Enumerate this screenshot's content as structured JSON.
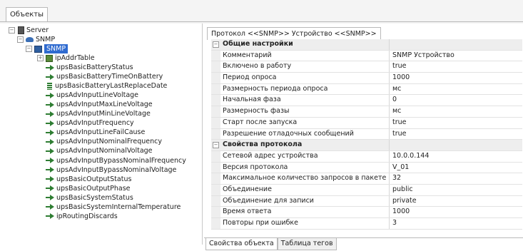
{
  "top_tab": "Объекты",
  "tree": {
    "server": "Server",
    "snmp_group": "SNMP",
    "snmp_device": "SNMP",
    "ip_addr_table": "ipAddrTable",
    "items": [
      "upsBasicBatteryStatus",
      "upsBasicBatteryTimeOnBattery",
      "upsBasicBatteryLastReplaceDate",
      "upsAdvInputLineVoltage",
      "upsAdvInputMaxLineVoltage",
      "upsAdvInputMinLineVoltage",
      "upsAdvInputFrequency",
      "upsAdvInputLineFailCause",
      "upsAdvInputNominalFrequency",
      "upsAdvInputNominalVoltage",
      "upsAdvInputBypassNominalFrequency",
      "upsAdvInputBypassNominalVoltage",
      "upsBasicOutputStatus",
      "upsBasicOutputPhase",
      "upsBasicSystemStatus",
      "upsBasicSystemInternalTemperature",
      "ipRoutingDiscards"
    ]
  },
  "panel_tab": "Протокол <<SNMP>> Устройство <<SNMP>>",
  "grid": {
    "cat1": "Общие настройки",
    "rows1": [
      {
        "label": "Комментарий",
        "value": "SNMP Устройство"
      },
      {
        "label": "Включено в работу",
        "value": "true"
      },
      {
        "label": "Период опроса",
        "value": "1000"
      },
      {
        "label": "Размерность периода опроса",
        "value": "мс"
      },
      {
        "label": "Начальная фаза",
        "value": "0"
      },
      {
        "label": "Размерность фазы",
        "value": "мс"
      },
      {
        "label": "Старт после запуска",
        "value": "true"
      },
      {
        "label": "Разрешение отладочных сообщений",
        "value": "true"
      }
    ],
    "cat2": "Свойства протокола",
    "rows2": [
      {
        "label": "Сетевой адрес устройства",
        "value": "10.0.0.144"
      },
      {
        "label": "Версия протокола",
        "value": "V_01"
      },
      {
        "label": "Максимальное количество запросов в пакете",
        "value": "32"
      },
      {
        "label": "Объединение",
        "value": "public"
      },
      {
        "label": "Объединение для записи",
        "value": "private"
      },
      {
        "label": "Время ответа",
        "value": "1000"
      },
      {
        "label": "Повторы при ошибке",
        "value": "3"
      }
    ]
  },
  "bottom_tabs": [
    "Свойства объекта",
    "Таблица тегов"
  ]
}
